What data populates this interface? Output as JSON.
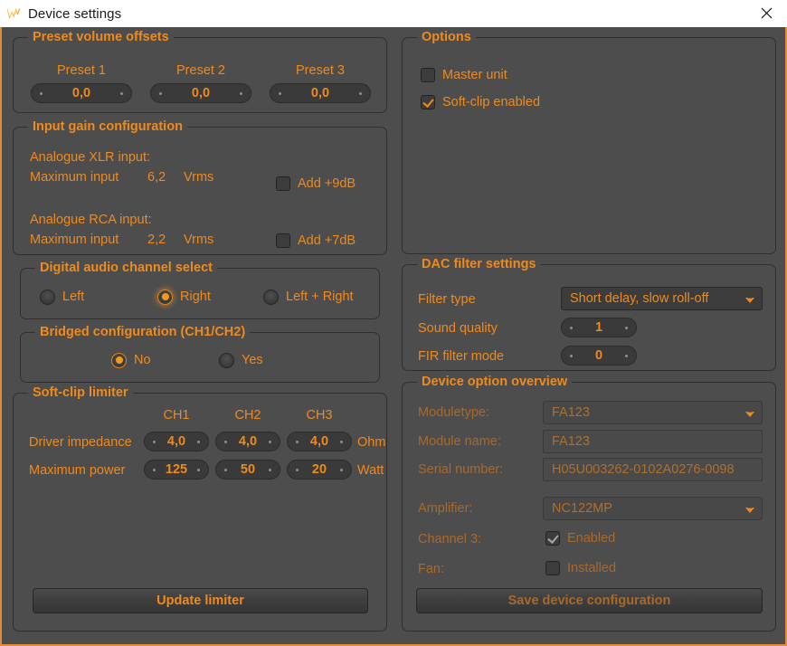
{
  "window": {
    "title": "Device settings",
    "app_icon": "wave-logo-icon",
    "close_label": "✕",
    "accent": "#ef8a1b",
    "background": "#4d4d4d",
    "border": "#e08a3c"
  },
  "preset_volume_offsets": {
    "legend": "Preset volume offsets",
    "columns": [
      {
        "label": "Preset 1",
        "value": "0,0"
      },
      {
        "label": "Preset 2",
        "value": "0,0"
      },
      {
        "label": "Preset 3",
        "value": "0,0"
      }
    ]
  },
  "input_gain": {
    "legend": "Input gain configuration",
    "xlr": {
      "title": "Analogue XLR input:",
      "max_label": "Maximum input",
      "max_value": "6,2",
      "unit": "Vrms",
      "add_label": "Add +9dB",
      "add_checked": false
    },
    "rca": {
      "title": "Analogue RCA input:",
      "max_label": "Maximum input",
      "max_value": "2,2",
      "unit": "Vrms",
      "add_label": "Add +7dB",
      "add_checked": false
    }
  },
  "digital_audio": {
    "legend": "Digital audio channel select",
    "options": [
      {
        "label": "Left",
        "selected": false
      },
      {
        "label": "Right",
        "selected": true
      },
      {
        "label": "Left + Right",
        "selected": false
      }
    ]
  },
  "bridged": {
    "legend": "Bridged configuration (CH1/CH2)",
    "options": [
      {
        "label": "No",
        "selected": true
      },
      {
        "label": "Yes",
        "selected": false
      }
    ]
  },
  "soft_clip_limiter": {
    "legend": "Soft-clip limiter",
    "channels": [
      "CH1",
      "CH2",
      "CH3"
    ],
    "rows": [
      {
        "label": "Driver impedance",
        "values": [
          "4,0",
          "4,0",
          "4,0"
        ],
        "unit": "Ohm"
      },
      {
        "label": "Maximum power",
        "values": [
          "125",
          "50",
          "20"
        ],
        "unit": "Watt"
      }
    ],
    "update_button": "Update limiter"
  },
  "options": {
    "legend": "Options",
    "items": [
      {
        "label": "Master unit",
        "checked": false
      },
      {
        "label": "Soft-clip enabled",
        "checked": true
      }
    ]
  },
  "dac_filter": {
    "legend": "DAC filter settings",
    "filter_type": {
      "label": "Filter type",
      "value": "Short delay, slow roll-off"
    },
    "sound_quality": {
      "label": "Sound quality",
      "value": "1"
    },
    "fir_filter_mode": {
      "label": "FIR filter mode",
      "value": "0"
    }
  },
  "device_overview": {
    "legend": "Device option overview",
    "moduletype": {
      "label": "Moduletype:",
      "value": "FA123"
    },
    "module_name": {
      "label": "Module name:",
      "value": "FA123"
    },
    "serial_number": {
      "label": "Serial number:",
      "value": "H05U003262-0102A0276-0098"
    },
    "amplifier": {
      "label": "Amplifier:",
      "value": "NC122MP"
    },
    "channel3": {
      "label": "Channel 3:",
      "checkbox_label": "Enabled",
      "checked": true
    },
    "fan": {
      "label": "Fan:",
      "checkbox_label": "Installed",
      "checked": false
    },
    "save_button": "Save device configuration"
  }
}
